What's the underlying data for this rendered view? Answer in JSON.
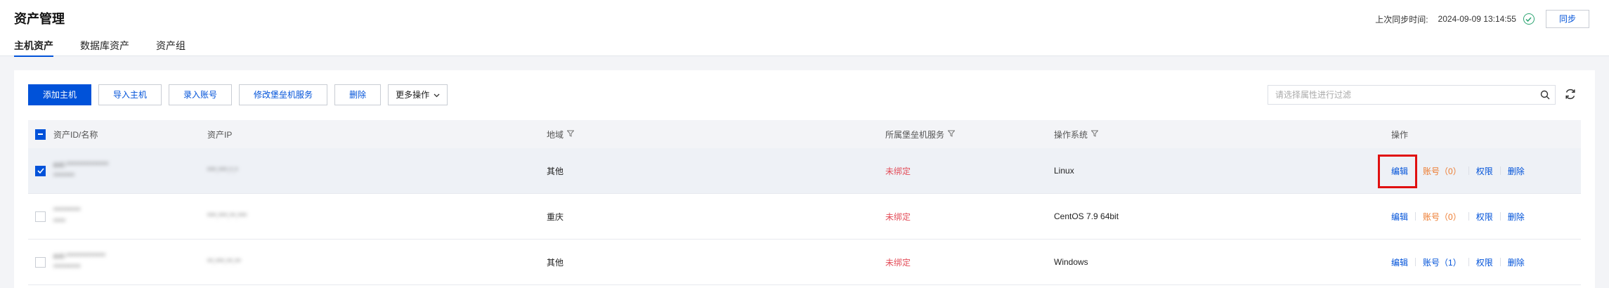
{
  "header": {
    "title": "资产管理",
    "tabs": [
      "主机资产",
      "数据库资产",
      "资产组"
    ],
    "last_sync_label": "上次同步时间:",
    "last_sync_time": "2024-09-09 13:14:55",
    "sync_button": "同步"
  },
  "toolbar": {
    "add_host": "添加主机",
    "import_host": "导入主机",
    "import_account": "录入账号",
    "modify_bastion": "修改堡垒机服务",
    "delete": "删除",
    "more_actions": "更多操作"
  },
  "search": {
    "placeholder": "请选择属性进行过滤"
  },
  "table": {
    "columns": {
      "id": "资产ID/名称",
      "ip": "资产IP",
      "region": "地域",
      "bastion": "所属堡垒机服务",
      "os": "操作系统",
      "ops": "操作"
    },
    "rows": [
      {
        "id": "ext-**************",
        "name": "*******",
        "ip": "***.***.*.*",
        "region": "其他",
        "bastion": "未绑定",
        "os": "Linux",
        "edit": "编辑",
        "account": "账号（0）",
        "permission": "权限",
        "delete": "删除",
        "selected": true
      },
      {
        "id": "*********",
        "name": "****",
        "ip": "***.***.**.***",
        "region": "重庆",
        "bastion": "未绑定",
        "os": "CentOS 7.9 64bit",
        "edit": "编辑",
        "account": "账号（0）",
        "permission": "权限",
        "delete": "删除",
        "selected": false
      },
      {
        "id": "ext-*************",
        "name": "*********",
        "ip": "**.***.**.**",
        "region": "其他",
        "bastion": "未绑定",
        "os": "Windows",
        "edit": "编辑",
        "account": "账号（1）",
        "permission": "权限",
        "delete": "删除",
        "selected": false
      }
    ]
  },
  "colors": {
    "primary": "#0052d9",
    "unbound": "#e34d59",
    "account_zero": "#ed7b2f",
    "highlight_box": "#e01010"
  }
}
